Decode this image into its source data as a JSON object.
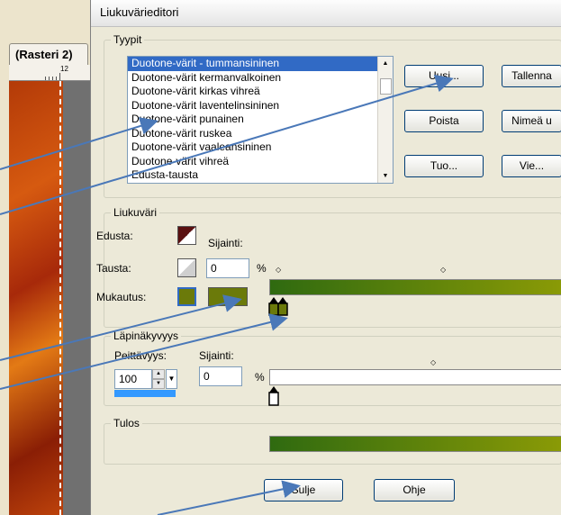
{
  "background_app": {
    "tab_label": "(Rasteri 2)",
    "ruler_mark": "12"
  },
  "dialog": {
    "title": "Liukuvärieditori",
    "types": {
      "group_label": "Tyypit",
      "items": [
        "Duotone-värit - tummansininen",
        "Duotone-värit kermanvalkoinen",
        "Duotone-värit kirkas vihreä",
        "Duotone-värit laventelinsininen",
        "Duotone-värit punainen",
        "Duotone-värit ruskea",
        "Duotone-värit vaaleansininen",
        "Duotone-värit vihreä",
        "Edusta-tausta"
      ],
      "selected_index": 0,
      "buttons": {
        "new": "Uusi...",
        "save": "Tallenna",
        "delete": "Poista",
        "rename": "Nimeä u",
        "import": "Tuo...",
        "export": "Vie..."
      }
    },
    "gradient": {
      "group_label": "Liukuväri",
      "foreground_label": "Edusta:",
      "background_label": "Tausta:",
      "custom_label": "Mukautus:",
      "location_label": "Sijainti:",
      "location_value": "0",
      "percent": "%",
      "custom_color": "#6b7a0a",
      "gradient_start": "#2f6a10",
      "gradient_end": "#8a9a06"
    },
    "opacity": {
      "group_label": "Läpinäkyvyys",
      "opacity_label": "Peittävyys:",
      "opacity_value": "100",
      "location_label": "Sijainti:",
      "location_value": "0",
      "percent": "%"
    },
    "result": {
      "group_label": "Tulos"
    },
    "footer": {
      "close": "Sulje",
      "help": "Ohje"
    }
  },
  "colors": {
    "arrow": "#4a78b8",
    "selection": "#316ac5"
  }
}
